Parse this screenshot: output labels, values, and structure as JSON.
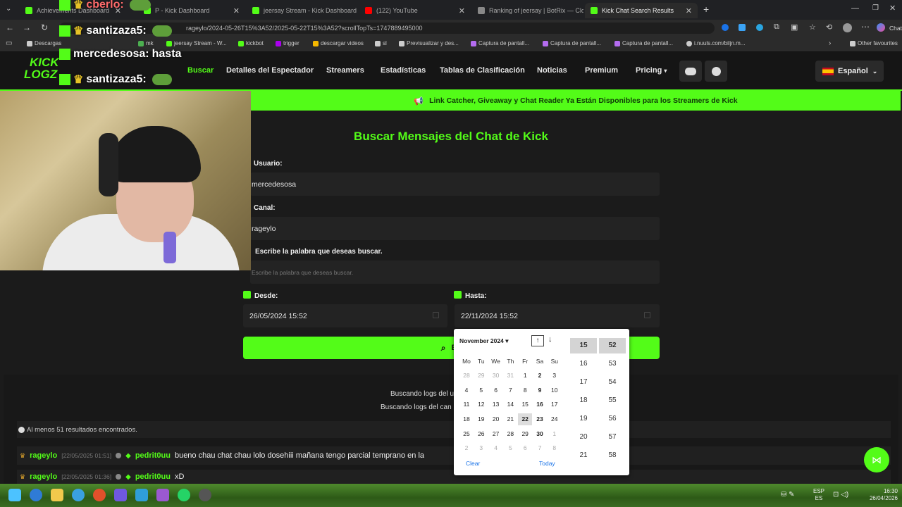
{
  "browser": {
    "tabs": [
      {
        "label": "Achievements Dashboard",
        "color": "#53fc18"
      },
      {
        "label": "P - Kick Dashboard",
        "color": "#53fc18"
      },
      {
        "label": "jeersay Stream - Kick Dashboard",
        "color": "#53fc18"
      },
      {
        "label": "(122) YouTube",
        "color": "#ff0000"
      },
      {
        "label": "Ranking of jeersay | BotRix — Clo...",
        "color": "#888888"
      },
      {
        "label": "Kick Chat Search Results",
        "color": "#53fc18"
      }
    ],
    "url": "rageylo/2024-05-26T15%3A52/2025-05-22T15%3A52?scrollTopTs=1747889495000",
    "bookmarks": [
      "Descargas",
      "mk",
      "jeersay Stream - W...",
      "kickbot",
      "trigger",
      "descargar videos",
      "sl",
      "Previsualizar y des...",
      "Captura de pantall...",
      "Captura de pantall...",
      "Captura de pantall...",
      "i.nuuls.com/biljn.m..."
    ],
    "other_favourites": "Other favourites",
    "chat_label": "Chat"
  },
  "site": {
    "logo_top": "KICK",
    "logo_bottom": "LOGZ",
    "nav": [
      "Buscar",
      "Detalles del Espectador",
      "Streamers",
      "Estadísticas",
      "Tablas de Clasificación",
      "Noticias",
      "Premium",
      "Pricing"
    ],
    "language": "Español",
    "banner": "Link Catcher, Giveaway y Chat Reader Ya Están Disponibles para los Streamers de Kick",
    "title": "Buscar Mensajes del Chat de Kick",
    "user_label": "Usuario:",
    "user_value": "mercedesosa",
    "channel_label": "Canal:",
    "channel_value": "rageylo",
    "word_label": "Escribe la palabra que deseas buscar.",
    "word_placeholder": "Escribe la palabra que deseas buscar.",
    "from_label": "Desde:",
    "from_value": "26/05/2024 15:52",
    "to_label": "Hasta:",
    "to_value": "22/11/2024 15:52",
    "search_button": "Bu",
    "status1": "Buscando logs del u",
    "status2": "Buscando logs del can",
    "results_count": "Al menos 51 resultados encontrados.",
    "rows": [
      {
        "channel": "rageylo",
        "time": "[22/05/2025 01:51]",
        "user": "pedrit0uu",
        "message": "bueno chau chat chau lolo dosehiii mañana tengo parcial temprano en la"
      },
      {
        "channel": "rageylo",
        "time": "[22/05/2025 01:36]",
        "user": "pedrit0uu",
        "message": "xD"
      }
    ]
  },
  "overlay_chat": [
    {
      "name": "cberlo:",
      "text": ""
    },
    {
      "name": "santizaza5:",
      "text": ""
    },
    {
      "name": "mercedesosa:",
      "text": "hasta"
    },
    {
      "name": "santizaza5:",
      "text": ""
    }
  ],
  "datepicker": {
    "month": "November 2024",
    "weekdays": [
      "Mo",
      "Tu",
      "We",
      "Th",
      "Fr",
      "Sa",
      "Su"
    ],
    "weeks": [
      [
        "28",
        "29",
        "30",
        "31",
        "1",
        "2",
        "3"
      ],
      [
        "4",
        "5",
        "6",
        "7",
        "8",
        "9",
        "10"
      ],
      [
        "11",
        "12",
        "13",
        "14",
        "15",
        "16",
        "17"
      ],
      [
        "18",
        "19",
        "20",
        "21",
        "22",
        "23",
        "24"
      ],
      [
        "25",
        "26",
        "27",
        "28",
        "29",
        "30",
        "1"
      ],
      [
        "2",
        "3",
        "4",
        "5",
        "6",
        "7",
        "8"
      ]
    ],
    "selected_day": "22",
    "hours": [
      "15",
      "16",
      "17",
      "18",
      "19",
      "20",
      "21"
    ],
    "minutes": [
      "52",
      "53",
      "54",
      "55",
      "56",
      "57",
      "58"
    ],
    "clear": "Clear",
    "today": "Today"
  },
  "taskbar": {
    "lang": "ESP",
    "lang_sub": "ES",
    "time": "16:30",
    "date": "26/04/2026"
  },
  "colors": {
    "accent": "#53fc18",
    "background": "#1b1b1b"
  }
}
